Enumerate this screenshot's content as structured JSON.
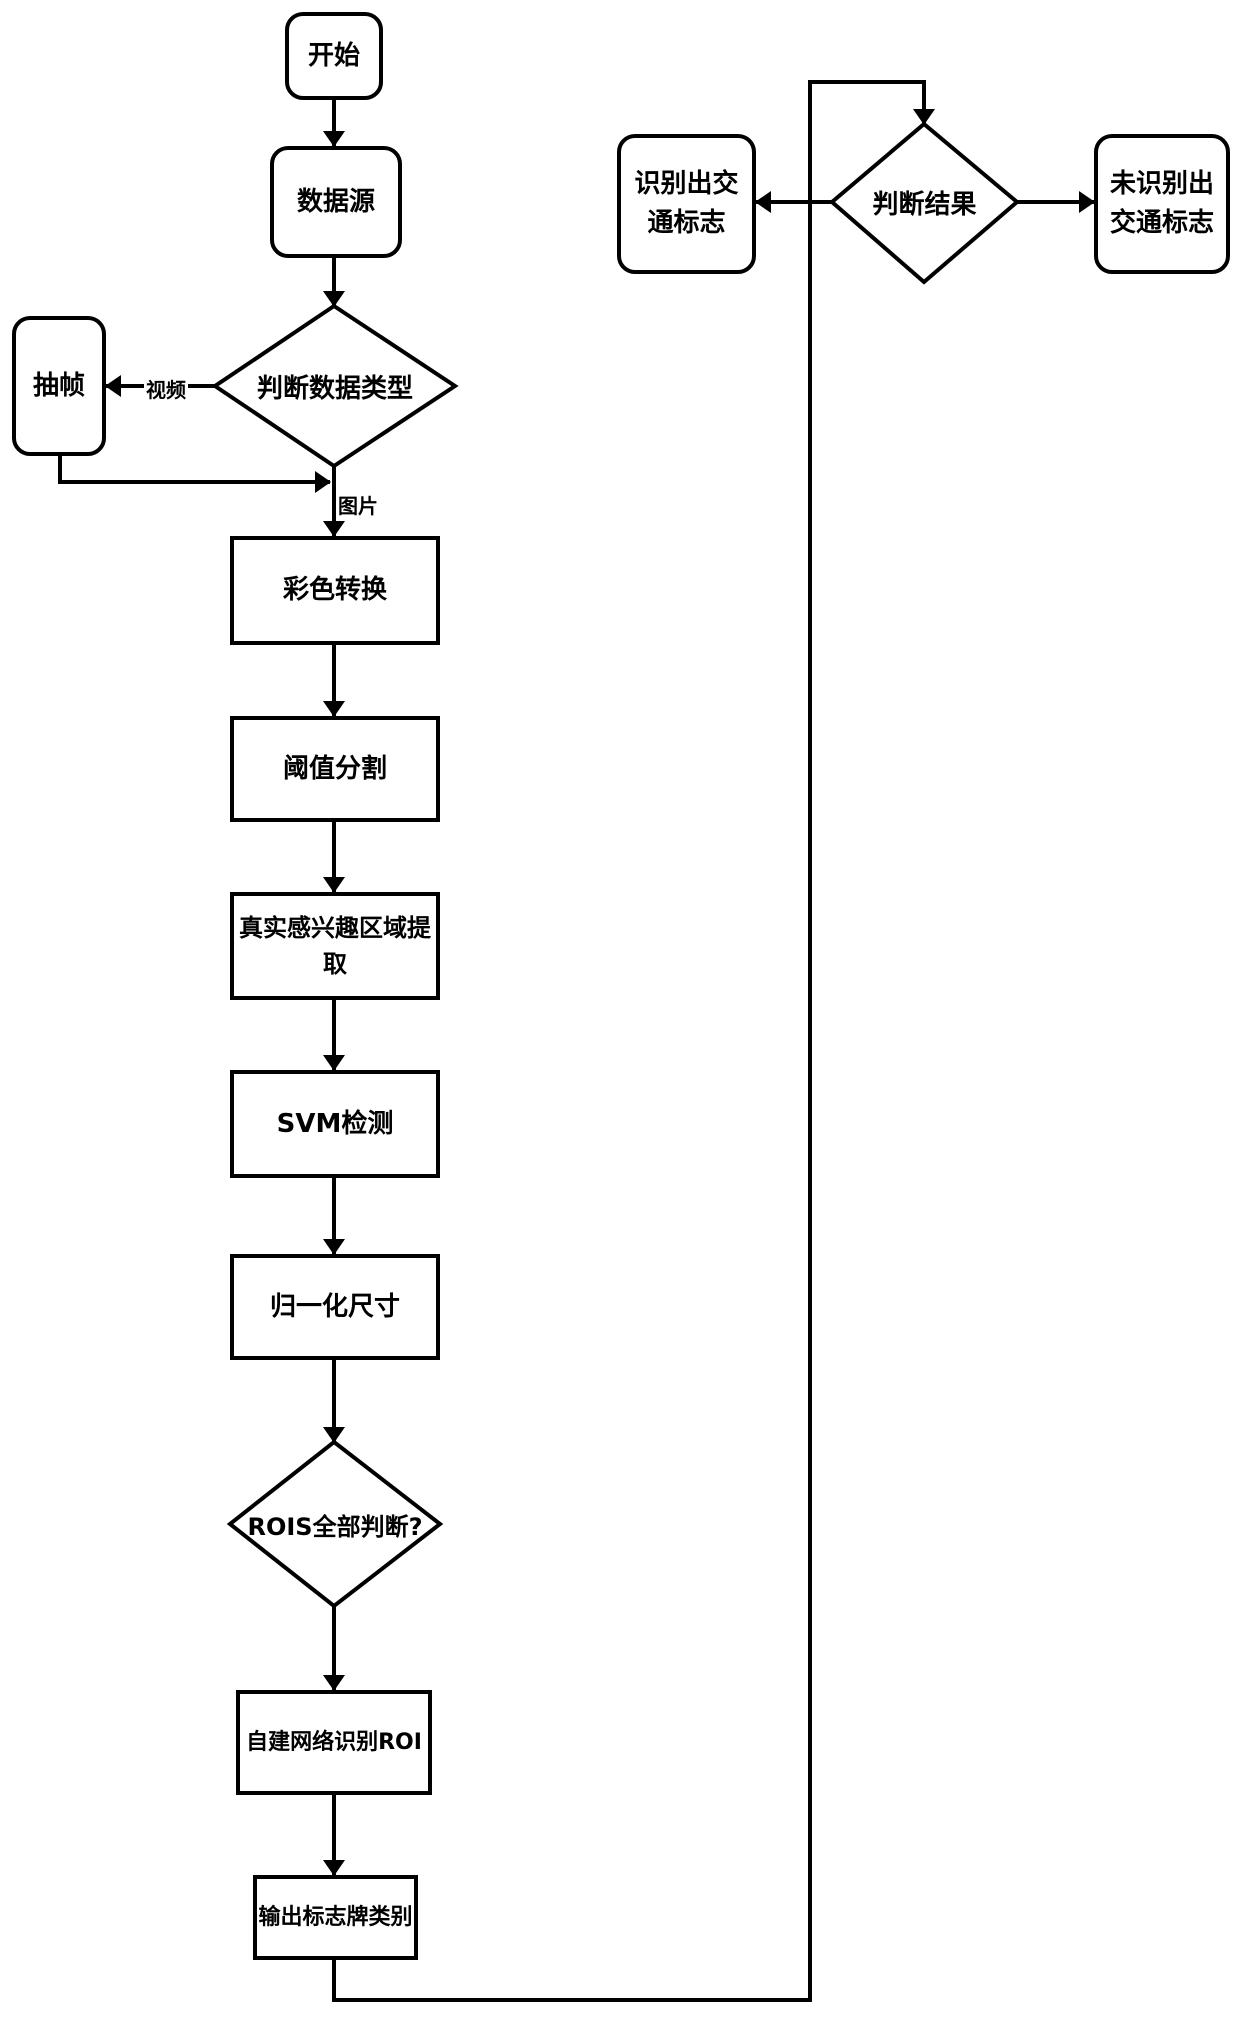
{
  "diagram": {
    "type": "flowchart",
    "nodes": {
      "start": "开始",
      "data_source": "数据源",
      "judge_type": "判断数据类型",
      "extract_frames": "抽帧",
      "color_conversion": "彩色转换",
      "threshold_segmentation": "阈值分割",
      "roi_extraction": "真实感兴趣区域提取",
      "svm_detection": "SVM检测",
      "normalize_size": "归一化尺寸",
      "rois_all_judged": "ROIS全部判断?",
      "custom_network_recognition": "自建网络识别ROI",
      "output_category": "输出标志牌类别",
      "judge_result": "判断结果",
      "recognized": "识别出交通标志",
      "not_recognized": "未识别出交通标志"
    },
    "edge_labels": {
      "video": "视频",
      "image": "图片"
    },
    "edges": [
      {
        "from": "start",
        "to": "data_source"
      },
      {
        "from": "data_source",
        "to": "judge_type"
      },
      {
        "from": "judge_type",
        "to": "extract_frames",
        "label": "视频"
      },
      {
        "from": "extract_frames",
        "to": "color_conversion"
      },
      {
        "from": "judge_type",
        "to": "color_conversion",
        "label": "图片"
      },
      {
        "from": "color_conversion",
        "to": "threshold_segmentation"
      },
      {
        "from": "threshold_segmentation",
        "to": "roi_extraction"
      },
      {
        "from": "roi_extraction",
        "to": "svm_detection"
      },
      {
        "from": "svm_detection",
        "to": "normalize_size"
      },
      {
        "from": "normalize_size",
        "to": "rois_all_judged"
      },
      {
        "from": "rois_all_judged",
        "to": "custom_network_recognition"
      },
      {
        "from": "custom_network_recognition",
        "to": "output_category"
      },
      {
        "from": "output_category",
        "to": "judge_result"
      },
      {
        "from": "judge_result",
        "to": "recognized"
      },
      {
        "from": "judge_result",
        "to": "not_recognized"
      }
    ]
  }
}
